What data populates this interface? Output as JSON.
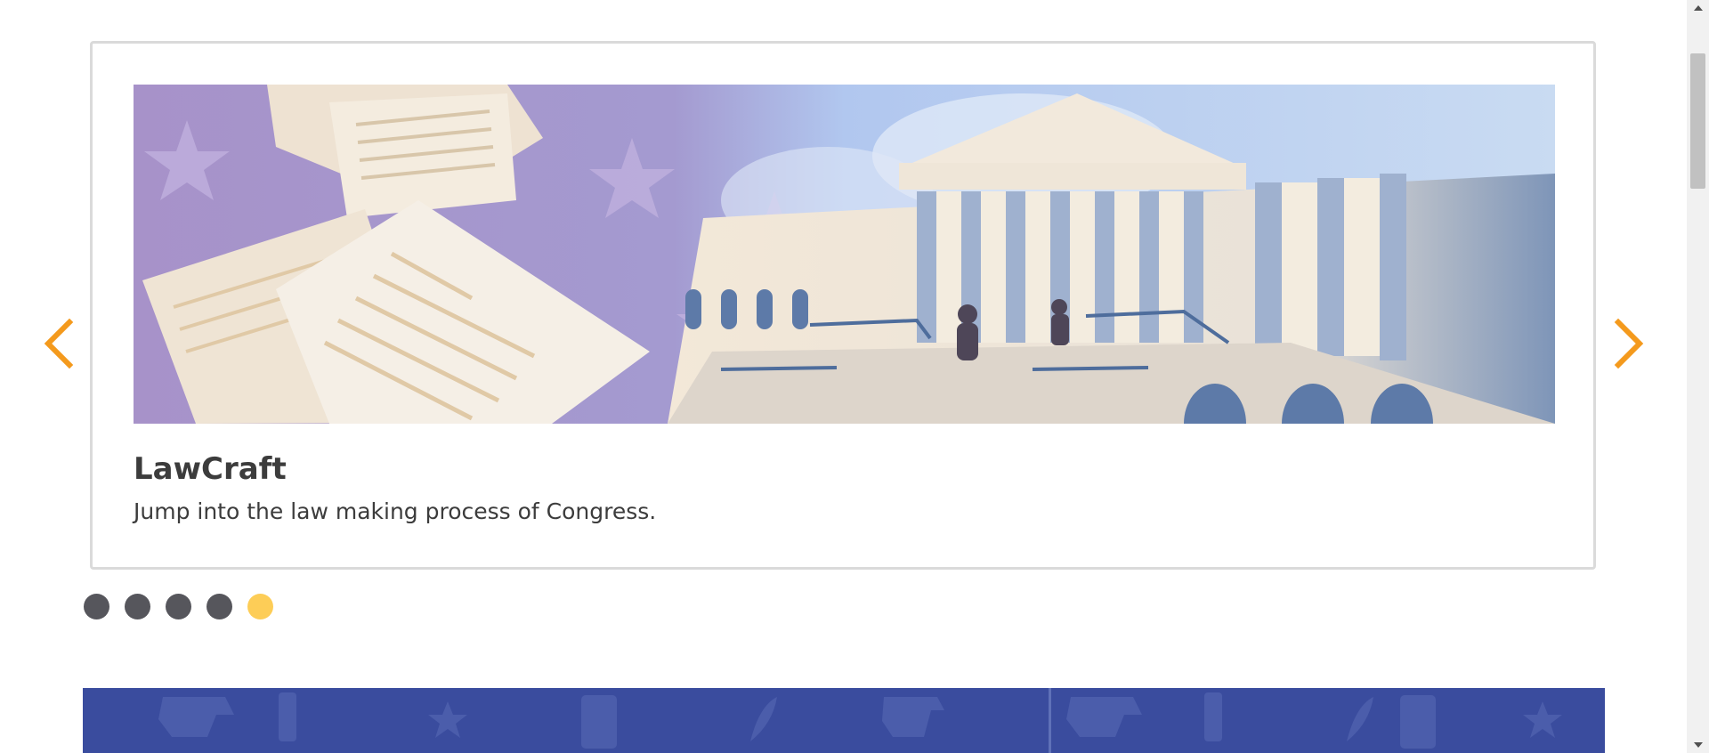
{
  "slide": {
    "title": "LawCraft",
    "description": "Jump into the law making process of Congress."
  },
  "carousel": {
    "prev_icon": "chevron-left-icon",
    "next_icon": "chevron-right-icon",
    "dot_count": 5,
    "active_dot": 5
  },
  "colors": {
    "arrow": "#f49a1d",
    "dot": "#56565c",
    "dot_active": "#fdcd57",
    "title": "#3c3c3c",
    "footer_band": "#3a4c9e",
    "card_border": "#dadada"
  }
}
